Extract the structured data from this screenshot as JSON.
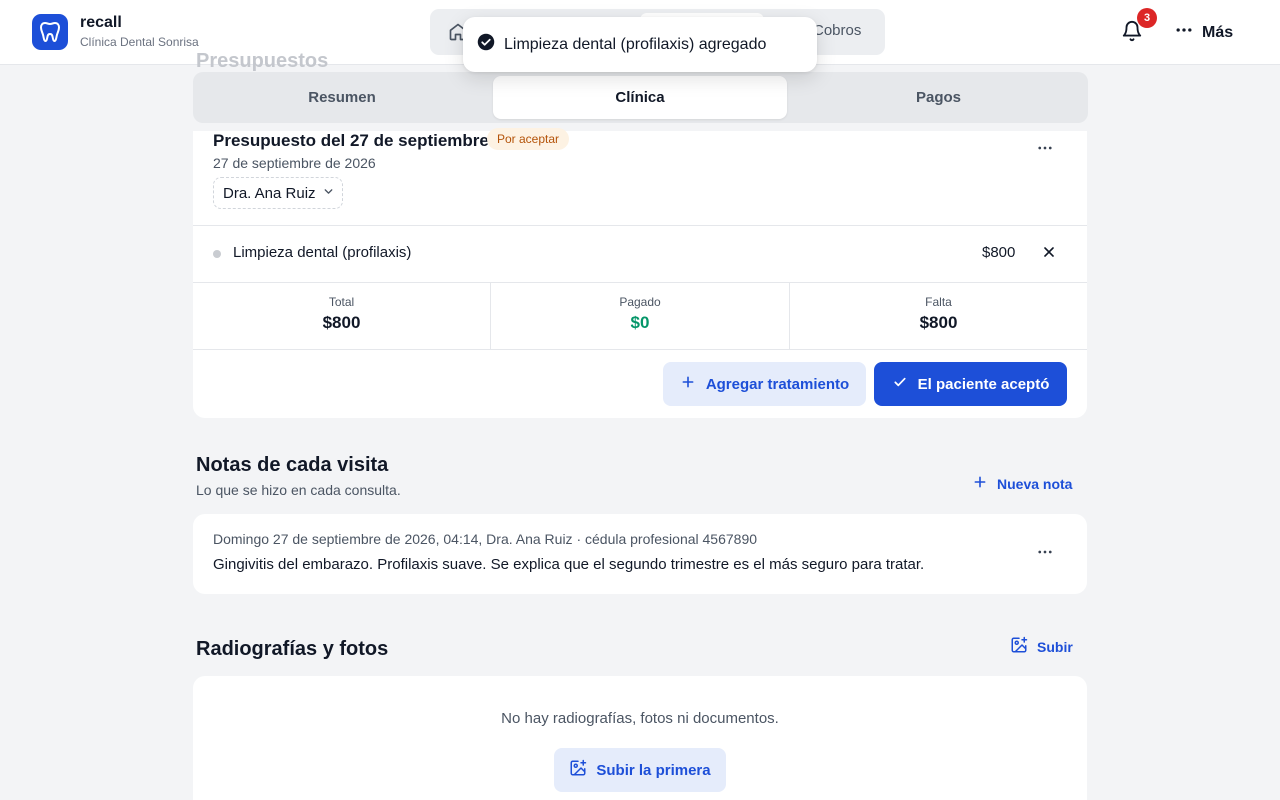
{
  "app": {
    "name": "recall",
    "clinic": "Clínica Dental Sonrisa"
  },
  "nav": {
    "cobros_label": "Cobros",
    "notification_count": "3",
    "more_label": "Más"
  },
  "toast": {
    "message": "Limpieza dental (profilaxis) agregado"
  },
  "section_peek": "Presupuestos",
  "tabs": [
    {
      "label": "Resumen",
      "active": false
    },
    {
      "label": "Clínica",
      "active": true
    },
    {
      "label": "Pagos",
      "active": false
    }
  ],
  "budget": {
    "title": "Presupuesto del 27 de septiembre",
    "status": "Por aceptar",
    "date": "27 de septiembre de 2026",
    "doctor": "Dra. Ana Ruiz",
    "items": [
      {
        "name": "Limpieza dental (profilaxis)",
        "price": "$800"
      }
    ],
    "summary": {
      "total_label": "Total",
      "total": "$800",
      "paid_label": "Pagado",
      "paid": "$0",
      "due_label": "Falta",
      "due": "$800"
    },
    "add_treatment_label": "Agregar tratamiento",
    "accept_label": "El paciente aceptó"
  },
  "notes": {
    "title": "Notas de cada visita",
    "subtitle": "Lo que se hizo en cada consulta.",
    "new_label": "Nueva nota",
    "entries": [
      {
        "meta": "Domingo 27 de septiembre de 2026, 04:14, Dra. Ana Ruiz · cédula profesional 4567890",
        "text": "Gingivitis del embarazo. Profilaxis suave. Se explica que el segundo trimestre es el más seguro para tratar."
      }
    ]
  },
  "files": {
    "title": "Radiografías y fotos",
    "upload_label": "Subir",
    "empty_text": "No hay radiografías, fotos ni documentos.",
    "upload_first_label": "Subir la primera"
  },
  "colors": {
    "accent": "#1d4fd8",
    "paid": "#059669",
    "badge": "#dc2626",
    "status_bg": "#fdf2e3",
    "status_text": "#b45309"
  }
}
